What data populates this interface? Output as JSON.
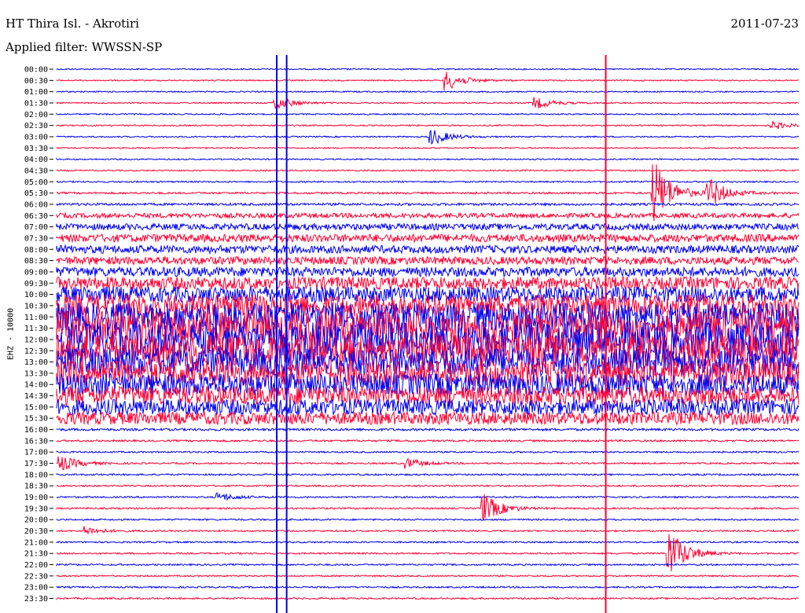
{
  "header": {
    "station": "HT Thira Isl. - Akrotiri",
    "date": "2011-07-23",
    "filter_label": "Applied filter: WWSSN-SP"
  },
  "chart_data": {
    "type": "line",
    "title": "HT Thira Isl. - Akrotiri",
    "subtitle": "Applied filter: WWSSN-SP",
    "date": "2011-07-23",
    "ylabel": "EHZ - 10000",
    "xlabel": "",
    "rows": [
      "00:00",
      "00:30",
      "01:00",
      "01:30",
      "02:00",
      "02:30",
      "03:00",
      "03:30",
      "04:00",
      "04:30",
      "05:00",
      "05:30",
      "06:00",
      "06:30",
      "07:00",
      "07:30",
      "08:00",
      "08:30",
      "09:00",
      "09:30",
      "10:00",
      "10:30",
      "11:00",
      "11:30",
      "12:00",
      "12:30",
      "13:00",
      "13:30",
      "14:00",
      "14:30",
      "15:00",
      "15:30",
      "16:00",
      "16:30",
      "17:00",
      "17:30",
      "18:00",
      "18:30",
      "19:00",
      "19:30",
      "20:00",
      "20:30",
      "21:00",
      "21:30",
      "22:00",
      "22:30",
      "23:00",
      "23:30"
    ],
    "trace_noise": [
      0.8,
      0.8,
      0.8,
      0.8,
      0.8,
      0.8,
      0.8,
      0.8,
      0.8,
      0.8,
      0.9,
      1.2,
      1.5,
      3,
      4,
      5,
      5,
      5,
      6,
      8,
      10,
      14,
      18,
      22,
      22,
      20,
      18,
      16,
      14,
      12,
      10,
      8,
      1.5,
      1.2,
      1.0,
      1.0,
      1.0,
      1.0,
      1.0,
      1.0,
      1.0,
      1.0,
      1.0,
      1.0,
      1.0,
      1.0,
      1.0,
      1.0
    ],
    "series_colors": {
      "even_rows": "#0000ee",
      "odd_rows": "#ff0033"
    },
    "events": [
      {
        "row": 1,
        "minute": 15.8,
        "amp": 12
      },
      {
        "row": 3,
        "minute": 8.9,
        "amp": 8
      },
      {
        "row": 3,
        "minute": 19.4,
        "amp": 7
      },
      {
        "row": 5,
        "minute": 29,
        "amp": 5
      },
      {
        "row": 6,
        "minute": 15.2,
        "amp": 10
      },
      {
        "row": 11,
        "minute": 24.2,
        "amp": 40
      },
      {
        "row": 11,
        "minute": 26.4,
        "amp": 18
      },
      {
        "row": 35,
        "minute": 0.2,
        "amp": 10
      },
      {
        "row": 35,
        "minute": 14.2,
        "amp": 6
      },
      {
        "row": 38,
        "minute": 6.6,
        "amp": 5
      },
      {
        "row": 39,
        "minute": 17.3,
        "amp": 18
      },
      {
        "row": 41,
        "minute": 1.2,
        "amp": 5
      },
      {
        "row": 43,
        "minute": 24.8,
        "amp": 30
      }
    ],
    "vertical_spikes": [
      {
        "minute": 8.9,
        "color": "#0000ee"
      },
      {
        "minute": 9.3,
        "color": "#0000ee"
      },
      {
        "minute": 22.2,
        "color": "#ff0033"
      }
    ]
  }
}
